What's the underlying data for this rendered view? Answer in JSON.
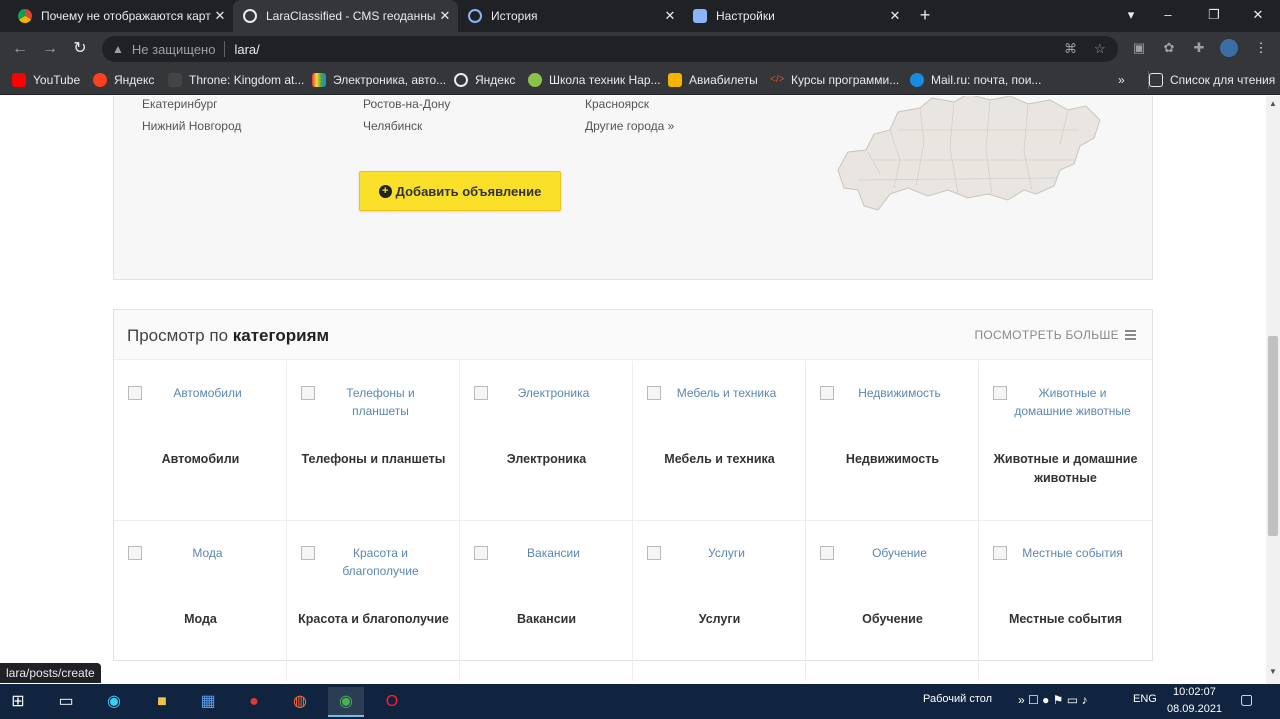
{
  "browser": {
    "tabs": [
      {
        "title": "Почему не отображаются картинки",
        "favicon": "chrome-icon"
      },
      {
        "title": "LaraClassified - CMS геоданных",
        "favicon": "globe-icon"
      },
      {
        "title": "История",
        "favicon": "history-icon"
      },
      {
        "title": "Настройки",
        "favicon": "gear-icon"
      }
    ],
    "security_label": "Не защищено",
    "url": "lara/",
    "bookmarks": [
      {
        "label": "YouTube",
        "icon": "youtube-icon",
        "color": "#ff0000"
      },
      {
        "label": "Яндекс",
        "icon": "yandex-icon",
        "color": "#fc3f1d"
      },
      {
        "label": "Throne: Kingdom at...",
        "icon": "game-icon",
        "color": "#444444"
      },
      {
        "label": "Электроника, авто...",
        "icon": "shop-icon",
        "color": "#7f3fbf"
      },
      {
        "label": "Яндекс",
        "icon": "globe-icon",
        "color": "#e8eaed"
      },
      {
        "label": "Школа техник Нар...",
        "icon": "school-icon",
        "color": "#8bc34a"
      },
      {
        "label": "Авиабилеты",
        "icon": "plane-icon",
        "color": "#f5b400"
      },
      {
        "label": "Курсы программи...",
        "icon": "code-icon",
        "color": "#e8462b"
      },
      {
        "label": "Mail.ru: почта, пои...",
        "icon": "mail-icon",
        "color": "#168de2"
      }
    ],
    "overflow_label": "»",
    "reading_list_label": "Список для чтения",
    "status_url": "lara/posts/create"
  },
  "cities": {
    "columns": [
      [
        "Екатеринбург",
        "Нижний Новгород"
      ],
      [
        "Ростов-на-Дону",
        "Челябинск"
      ],
      [
        "Красноярск",
        "Другие города »"
      ]
    ],
    "add_button_label": "Добавить объявление"
  },
  "categories": {
    "title_prefix": "Просмотр по",
    "title_bold": "категориям",
    "more_label": "ПОСМОТРЕТЬ БОЛЬШЕ",
    "items": [
      {
        "alt": "Автомобили",
        "name": "Автомобили"
      },
      {
        "alt": "Телефоны и планшеты",
        "name": "Телефоны и планшеты"
      },
      {
        "alt": "Электроника",
        "name": "Электроника"
      },
      {
        "alt": "Мебель и техника",
        "name": "Мебель и техника"
      },
      {
        "alt": "Недвижимость",
        "name": "Недвижимость"
      },
      {
        "alt": "Животные и домашние животные",
        "name": "Животные и домашние животные"
      },
      {
        "alt": "Мода",
        "name": "Мода"
      },
      {
        "alt": "Красота и благополучие",
        "name": "Красота и благополучие"
      },
      {
        "alt": "Вакансии",
        "name": "Вакансии"
      },
      {
        "alt": "Услуги",
        "name": "Услуги"
      },
      {
        "alt": "Обучение",
        "name": "Обучение"
      },
      {
        "alt": "Местные события",
        "name": "Местные события"
      }
    ]
  },
  "taskbar": {
    "desktop_label": "Рабочий стол",
    "lang": "ENG",
    "time": "10:02:07",
    "date": "08.09.2021"
  }
}
